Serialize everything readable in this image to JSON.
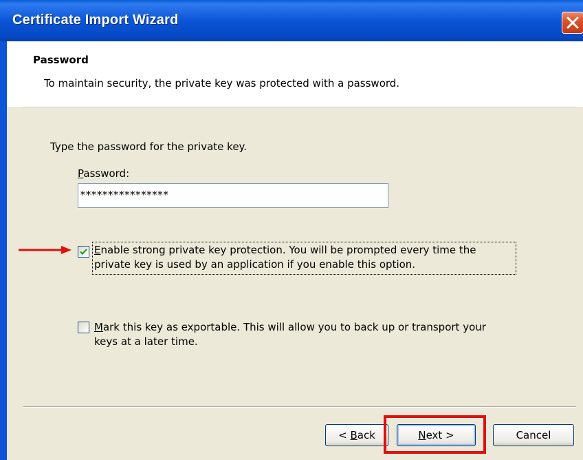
{
  "window": {
    "title": "Certificate Import Wizard"
  },
  "header": {
    "title": "Password",
    "subtitle": "To maintain security, the private key was protected with a password."
  },
  "body": {
    "instruction": "Type the password for the private key.",
    "password_label_first": "P",
    "password_label_rest": "assword:",
    "password_value": "****************",
    "strong_protection": {
      "checked": true,
      "line1_first": "E",
      "line1_rest": "nable strong private key protection. You will be prompted every time the",
      "line2": "private key is used by an application if you enable this option."
    },
    "exportable": {
      "checked": false,
      "line1_first": "M",
      "line1_rest": "ark this key as exportable. This will allow you to back up or transport your",
      "line2": "keys at a later time."
    }
  },
  "buttons": {
    "back_prefix": "< ",
    "back_first": "B",
    "back_rest": "ack",
    "next_first": "N",
    "next_rest": "ext >",
    "cancel": "Cancel"
  },
  "icons": {
    "close": "close-icon",
    "arrow": "red-arrow-annotation",
    "check": "checkmark-icon"
  },
  "colors": {
    "titlebar": "#0b55d6",
    "dialog_bg": "#ece9d8",
    "annotation": "#e01010",
    "close_button": "#d9532e"
  }
}
